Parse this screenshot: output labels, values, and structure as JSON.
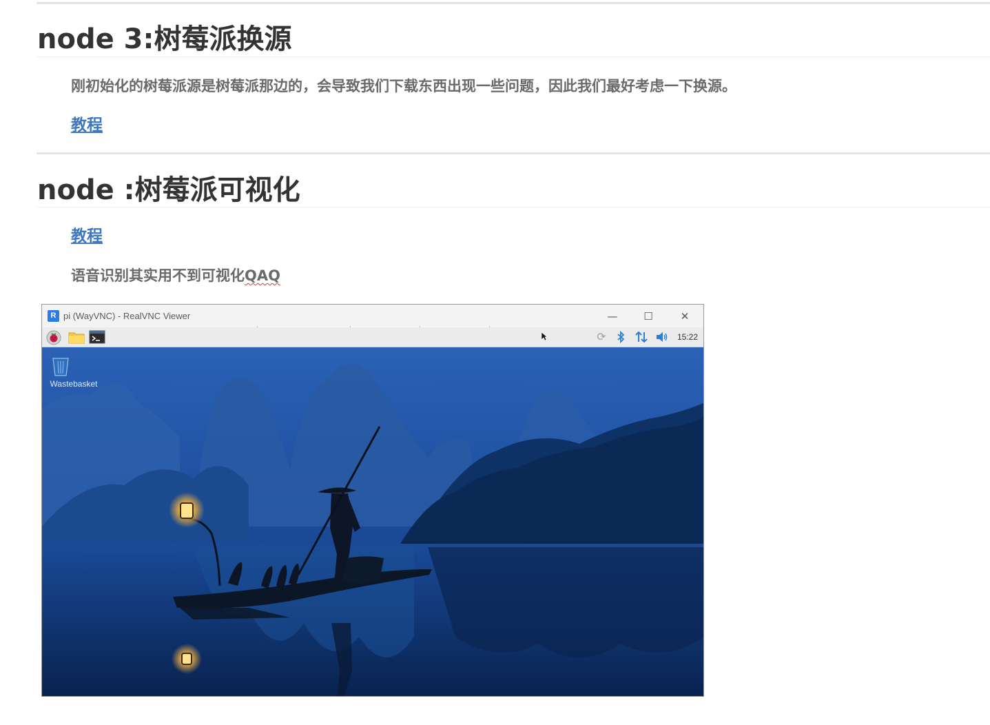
{
  "section1": {
    "heading": "node 3:树莓派换源",
    "description": "刚初始化的树莓派源是树莓派那边的，会导致我们下载东西出现一些问题，因此我们最好考虑一下换源。",
    "link": "教程"
  },
  "section2": {
    "heading": "node :树莓派可视化",
    "link": "教程",
    "note_prefix": "语音识别其实用不到可视化",
    "note_suffix": "QAQ"
  },
  "screenshot": {
    "window_title": "pi (WayVNC) - RealVNC Viewer",
    "logo_text": "R",
    "minimize_glyph": "—",
    "maximize_glyph": "☐",
    "close_glyph": "✕",
    "clock": "15:22",
    "desktop_icon_label": "Wastebasket",
    "taskbar_icons": [
      "raspberry-menu-icon",
      "file-manager-icon",
      "terminal-icon"
    ],
    "tray_icons": [
      "update-icon",
      "bluetooth-icon",
      "network-icon",
      "volume-icon"
    ],
    "accent_color": "#2c7fd6"
  },
  "colors": {
    "heading": "#333333",
    "body_text": "#6a6a6a",
    "link": "#4078c0",
    "rule": "#e4e4e4"
  }
}
